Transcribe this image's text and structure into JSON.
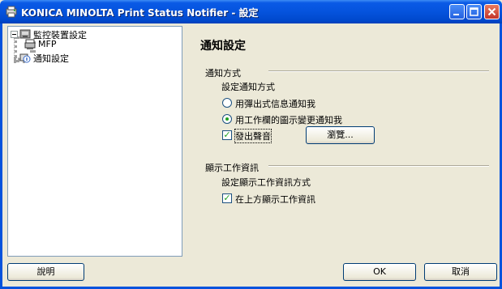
{
  "window": {
    "title": "KONICA MINOLTA Print Status Notifier - 設定"
  },
  "tree": {
    "items": [
      {
        "label": "監控裝置設定",
        "expanded": true
      },
      {
        "label": "MFP"
      },
      {
        "label": "通知設定"
      }
    ]
  },
  "panel": {
    "title": "通知設定",
    "notify_method": {
      "group_label": "通知方式",
      "sub_label": "設定通知方式",
      "options": [
        {
          "label": "用彈出式信息通知我",
          "selected": false
        },
        {
          "label": "用工作欄的圖示變更通知我",
          "selected": true
        }
      ],
      "sound": {
        "label": "發出聲音",
        "checked": true
      },
      "browse_label": "瀏覽..."
    },
    "job_info": {
      "group_label": "顯示工作資訊",
      "sub_label": "設定顯示工作資訊方式",
      "show_on_top": {
        "label": "在上方顯示工作資訊",
        "checked": true
      }
    }
  },
  "footer": {
    "help_label": "說明",
    "ok_label": "OK",
    "cancel_label": "取消"
  },
  "icons": {
    "app": "printer-status-icon",
    "folder": "device-folder-icon",
    "mfp": "mfp-device-icon",
    "notify": "notification-settings-icon"
  }
}
